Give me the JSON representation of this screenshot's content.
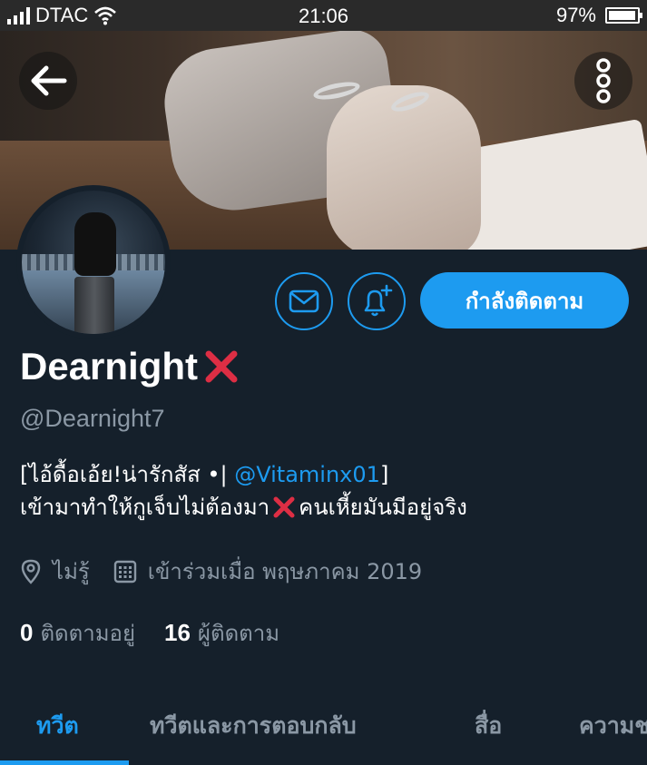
{
  "status_bar": {
    "carrier": "DTAC",
    "time": "21:06",
    "battery": "97%",
    "battery_level": 0.97
  },
  "header": {
    "back_icon": "arrow-left-icon",
    "more_icon": "more-vertical-icon"
  },
  "actions": {
    "message_icon": "envelope-icon",
    "notify_icon": "bell-plus-icon",
    "follow_label": "กำลังติดตาม"
  },
  "profile": {
    "name": "Dearnight",
    "name_emoji": "❌",
    "handle": "@Dearnight7",
    "bio_line1_prefix": "[ไอ้ดื้อเอ้ย!น่ารักสัส •| ",
    "bio_line1_link": "@Vitaminx01",
    "bio_line1_suffix": "]",
    "bio_line2_a": "เข้ามาทำให้กูเจ็บไม่ต้องมา",
    "bio_line2_emoji": "❌",
    "bio_line2_b": "คนเหี้ยมันมีอยู่จริง",
    "location": "ไม่รู้",
    "joined": "เข้าร่วมเมื่อ พฤษภาคม 2019",
    "following_count": "0",
    "following_label": "ติดตามอยู่",
    "followers_count": "16",
    "followers_label": "ผู้ติดตาม"
  },
  "tabs": [
    {
      "label": "ทวีต",
      "active": true
    },
    {
      "label": "ทวีตและการตอบกลับ",
      "active": false
    },
    {
      "label": "สื่อ",
      "active": false
    },
    {
      "label": "ความชอบ",
      "active": false
    }
  ],
  "colors": {
    "background": "#15202b",
    "accent": "#1d9bf0",
    "secondary_text": "#8b98a5",
    "emoji_red": "#dd2e44"
  }
}
